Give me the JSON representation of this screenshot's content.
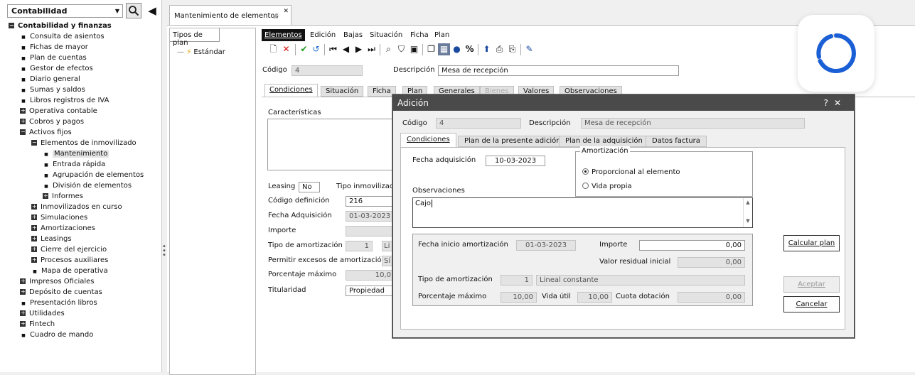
{
  "sidebar": {
    "module": "Contabilidad",
    "tree": [
      {
        "label": "Contabilidad y finanzas",
        "kind": "open",
        "level": 0,
        "bold": true
      },
      {
        "label": "Consulta de asientos",
        "kind": "leaf",
        "level": 1
      },
      {
        "label": "Fichas de mayor",
        "kind": "leaf",
        "level": 1
      },
      {
        "label": "Plan de cuentas",
        "kind": "leaf",
        "level": 1
      },
      {
        "label": "Gestor de efectos",
        "kind": "leaf",
        "level": 1
      },
      {
        "label": "Diario general",
        "kind": "leaf",
        "level": 1
      },
      {
        "label": "Sumas y saldos",
        "kind": "leaf",
        "level": 1
      },
      {
        "label": "Libros registros de IVA",
        "kind": "leaf",
        "level": 1
      },
      {
        "label": "Operativa contable",
        "kind": "plus",
        "level": 1
      },
      {
        "label": "Cobros y pagos",
        "kind": "plus",
        "level": 1
      },
      {
        "label": "Activos fijos",
        "kind": "open",
        "level": 1
      },
      {
        "label": "Elementos de inmovilizado",
        "kind": "open",
        "level": 2
      },
      {
        "label": "Mantenimiento",
        "kind": "leaf",
        "level": 3,
        "selected": true
      },
      {
        "label": "Entrada rápida",
        "kind": "leaf",
        "level": 3
      },
      {
        "label": "Agrupación de elementos",
        "kind": "leaf",
        "level": 3
      },
      {
        "label": "División de elementos",
        "kind": "leaf",
        "level": 3
      },
      {
        "label": "Informes",
        "kind": "plus",
        "level": 3
      },
      {
        "label": "Inmovilizados en curso",
        "kind": "plus",
        "level": 2
      },
      {
        "label": "Simulaciones",
        "kind": "plus",
        "level": 2
      },
      {
        "label": "Amortizaciones",
        "kind": "plus",
        "level": 2
      },
      {
        "label": "Leasings",
        "kind": "plus",
        "level": 2
      },
      {
        "label": "Cierre del ejercicio",
        "kind": "plus",
        "level": 2
      },
      {
        "label": "Procesos auxiliares",
        "kind": "plus",
        "level": 2
      },
      {
        "label": "Mapa de operativa",
        "kind": "leaf",
        "level": 2
      },
      {
        "label": "Impresos Oficiales",
        "kind": "plus",
        "level": 1
      },
      {
        "label": "Depósito de cuentas",
        "kind": "plus",
        "level": 1
      },
      {
        "label": "Presentación libros",
        "kind": "leaf",
        "level": 1
      },
      {
        "label": "Utilidades",
        "kind": "plus",
        "level": 1
      },
      {
        "label": "Fintech",
        "kind": "plus",
        "level": 1
      },
      {
        "label": "Cuadro de mando",
        "kind": "leaf",
        "level": 1
      }
    ]
  },
  "main": {
    "doc_tab": "Mantenimiento de elementos",
    "plan_header": "Tipos de plan",
    "plan_item": "Estándar",
    "menu": [
      "Elementos",
      "Edición",
      "Bajas",
      "Situación",
      "Ficha",
      "Plan"
    ],
    "codigo_label": "Código",
    "codigo_value": "4",
    "descripcion_label": "Descripción",
    "descripcion_value": "Mesa de recepción",
    "tabs": [
      "Condiciones",
      "Situación",
      "Ficha",
      "Plan",
      "Generales",
      "Bienes",
      "Valores",
      "Observaciones"
    ],
    "caracteristicas": "Características",
    "leasing_label": "Leasing",
    "leasing_value": "No",
    "tipo_inmov_label": "Tipo inmovilizado",
    "codigo_def_label": "Código definición",
    "codigo_def_value": "216",
    "fecha_adq_label": "Fecha Adquisición",
    "fecha_adq_value": "01-03-2023",
    "importe_label": "Importe",
    "tipo_amort_label": "Tipo de amortización",
    "tipo_amort_value": "1",
    "tipo_amort_trunc": "Li",
    "permitir_label": "Permitir excesos de amortización",
    "permitir_value": "Sí",
    "porcentaje_label": "Porcentaje máximo",
    "porcentaje_value": "10,0",
    "titularidad_label": "Titularidad",
    "titularidad_value": "Propiedad"
  },
  "dialog": {
    "title": "Adición",
    "help": "?",
    "close": "✕",
    "codigo_label": "Código",
    "codigo_value": "4",
    "descripcion_label": "Descripción",
    "descripcion_value": "Mesa de recepción",
    "tabs": [
      "Condiciones",
      "Plan de la presente adición",
      "Plan de la adquisición",
      "Datos factura"
    ],
    "fecha_adq_label": "Fecha adquisición",
    "fecha_adq_value": "10-03-2023",
    "amortizacion_label": "Amortización",
    "radio_proporcional": "Proporcional al elemento",
    "radio_vida": "Vida propia",
    "observaciones_label": "Observaciones",
    "observaciones_value": "Cajo",
    "fecha_inicio_label": "Fecha inicio amortización",
    "fecha_inicio_value": "01-03-2023",
    "importe_label": "Importe",
    "importe_value": "0,00",
    "valor_residual_label": "Valor residual inicial",
    "valor_residual_value": "0,00",
    "tipo_amort_label": "Tipo de amortización",
    "tipo_amort_code": "1",
    "tipo_amort_desc": "Lineal constante",
    "porcentaje_label": "Porcentaje máximo",
    "porcentaje_value": "10,00",
    "vida_util_label": "Vida útil",
    "vida_util_value": "10,00",
    "cuota_label": "Cuota dotación",
    "cuota_value": "0,00",
    "calcular_button": "Calcular plan",
    "aceptar_button": "Aceptar",
    "cancelar_button": "Cancelar"
  }
}
